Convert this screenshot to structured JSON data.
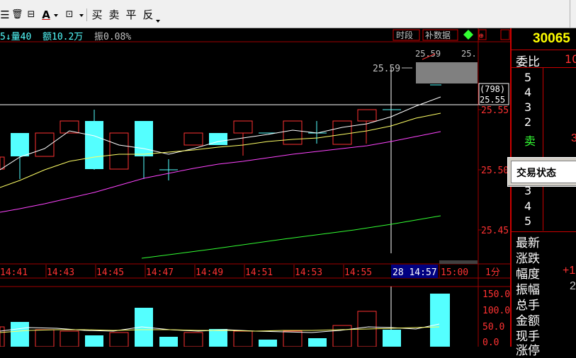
{
  "toolbar": {
    "buttons": [
      {
        "name": "list-icon",
        "glyph": "☰"
      },
      {
        "name": "trash-icon",
        "glyph": "🗑"
      },
      {
        "name": "lock-icon",
        "glyph": "🔒"
      },
      {
        "name": "font-color-icon",
        "glyph": "A"
      },
      {
        "name": "save-icon",
        "glyph": "💾"
      }
    ],
    "buy_label": "买",
    "sell_label": "卖",
    "flat_label": "平",
    "reverse_label": "反"
  },
  "info_bar": {
    "volume_text": "5↓量40",
    "amount_text": "额10.2万",
    "amplitude_text": "振0.08%",
    "period_button": "时段",
    "supplement_button": "补数据"
  },
  "price_axis": {
    "ticks": [
      "25.55",
      "25.50",
      "25.45"
    ],
    "current_count": "(798)",
    "current_price": "25.55",
    "top_labels": [
      "25.59",
      "25.59",
      "25."
    ],
    "high_label": "25.59"
  },
  "time_axis": {
    "ticks": [
      "14:41",
      "14:43",
      "14:45",
      "14:47",
      "14:49",
      "14:51",
      "14:53",
      "14:55"
    ],
    "cursor_label": "28 14:57",
    "end_label": "15:00",
    "period_label": "1分"
  },
  "volume_axis": {
    "ticks": [
      "150.0",
      "100.0",
      "50.0",
      "0.0"
    ]
  },
  "right_panel": {
    "code": "30065",
    "ratio_label": "委比",
    "ratio_value": "10",
    "sell_levels": [
      "5",
      "4",
      "3",
      "2"
    ],
    "sell_label": "卖",
    "sell_value": "3",
    "buy_levels": [
      "3",
      "4",
      "5"
    ],
    "quote_labels": [
      "最新",
      "涨跌",
      "幅度",
      "振幅",
      "总手",
      "金额",
      "现手",
      "涨停"
    ],
    "quote_values": [
      "",
      "",
      "+1",
      "2",
      "",
      "",
      "",
      ""
    ]
  },
  "dialog": {
    "title": "交易状态"
  },
  "colors": {
    "up": "#ff3232",
    "down": "#54ffff",
    "ma5": "#ffffff",
    "ma10": "#ffff66",
    "ma20": "#ff44ff",
    "ma60": "#33ff33",
    "grid": "#a00000"
  }
}
